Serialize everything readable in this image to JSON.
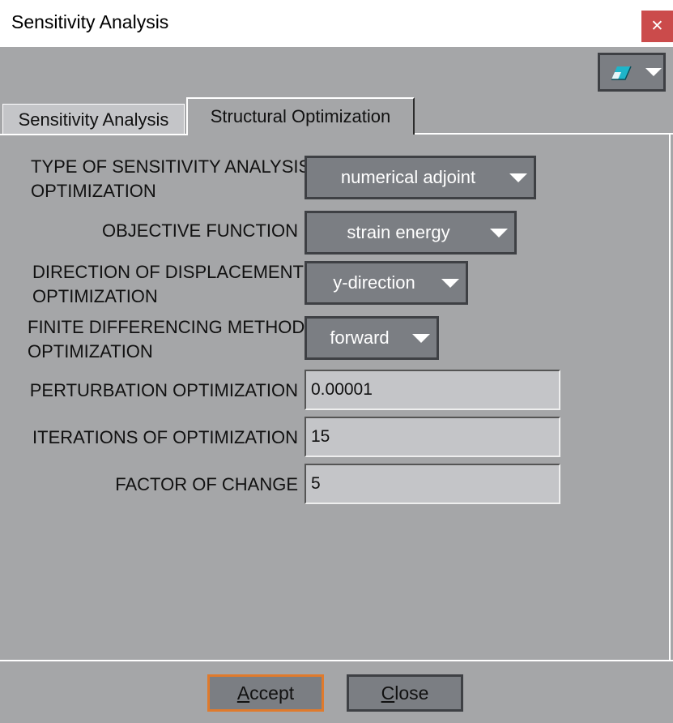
{
  "window": {
    "title": "Sensitivity Analysis",
    "close_glyph": "✕"
  },
  "toolbar": {
    "menu_icon": "eraser-icon"
  },
  "tabs": [
    {
      "label": "Sensitivity Analysis",
      "active": false
    },
    {
      "label": "Structural Optimization",
      "active": true
    }
  ],
  "form": {
    "sensitivity_type": {
      "label_line1": "TYPE OF SENSITIVITY ANALYSIS",
      "label_line2": "OPTIMIZATION",
      "value": "numerical adjoint"
    },
    "objective_function": {
      "label": "OBJECTIVE FUNCTION",
      "value": "strain energy"
    },
    "displacement_direction": {
      "label_line1": "DIRECTION OF DISPLACEMENT",
      "label_line2": "OPTIMIZATION",
      "value": "y-direction"
    },
    "finite_difference": {
      "label_line1": "FINITE DIFFERENCING METHOD",
      "label_line2": "OPTIMIZATION",
      "value": "forward"
    },
    "perturbation": {
      "label": "PERTURBATION OPTIMIZATION",
      "value": "0.00001"
    },
    "iterations": {
      "label": "ITERATIONS OF OPTIMIZATION",
      "value": "15"
    },
    "factor_of_change": {
      "label": "FACTOR OF CHANGE",
      "value": "5"
    }
  },
  "footer": {
    "accept": {
      "first": "A",
      "rest": "ccept"
    },
    "close": {
      "first": "C",
      "rest": "lose"
    }
  },
  "colors": {
    "panel_bg": "#a5a6a8",
    "control_bg": "#7b7e83",
    "close_red": "#cb4b4b",
    "default_button_border": "#e07a2c",
    "eraser_cyan": "#1fb5c9"
  }
}
